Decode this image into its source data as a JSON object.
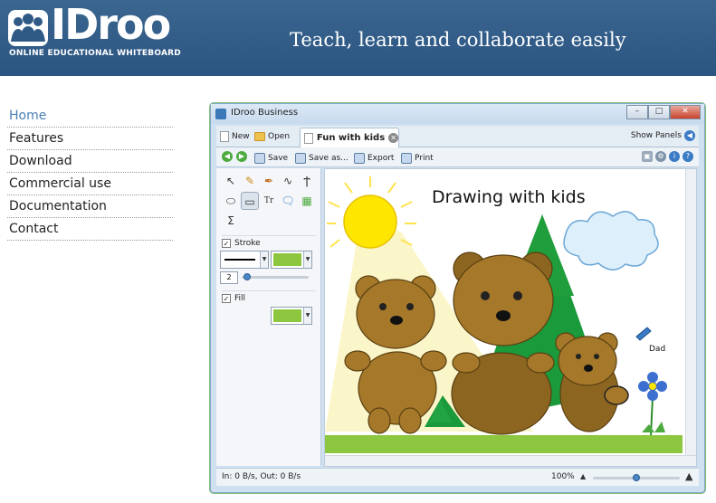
{
  "site": {
    "logo_text": "IDroo",
    "logo_subtitle": "ONLINE EDUCATIONAL WHITEBOARD",
    "tagline": "Teach, learn and collaborate easily"
  },
  "nav": {
    "items": [
      {
        "label": "Home",
        "active": true
      },
      {
        "label": "Features",
        "active": false
      },
      {
        "label": "Download",
        "active": false
      },
      {
        "label": "Commercial use",
        "active": false
      },
      {
        "label": "Documentation",
        "active": false
      },
      {
        "label": "Contact",
        "active": false
      }
    ]
  },
  "app": {
    "window_title": "IDroo Business",
    "tabs": {
      "new_label": "New",
      "open_label": "Open",
      "active_tab": "Fun with kids",
      "show_panels": "Show Panels"
    },
    "toolbar": {
      "save_label": "Save",
      "save_as_label": "Save as...",
      "export_label": "Export",
      "print_label": "Print"
    },
    "panel": {
      "stroke_label": "Stroke",
      "stroke_checked": true,
      "stroke_color": "#8dc63f",
      "stroke_width": "2",
      "fill_label": "Fill",
      "fill_checked": true,
      "fill_color": "#8dc63f"
    },
    "canvas": {
      "title": "Drawing with kids",
      "author_label": "Dad"
    },
    "status": {
      "traffic": "In: 0 B/s, Out: 0 B/s",
      "zoom": "100%",
      "zoom_level": 0.5
    }
  },
  "colors": {
    "header_bg": "#2f5a86",
    "nav_active": "#4a7fb5",
    "grass": "#8dc63f",
    "tree": "#1a9a3a",
    "bear": "#a5782a",
    "sun": "#ffe600"
  }
}
